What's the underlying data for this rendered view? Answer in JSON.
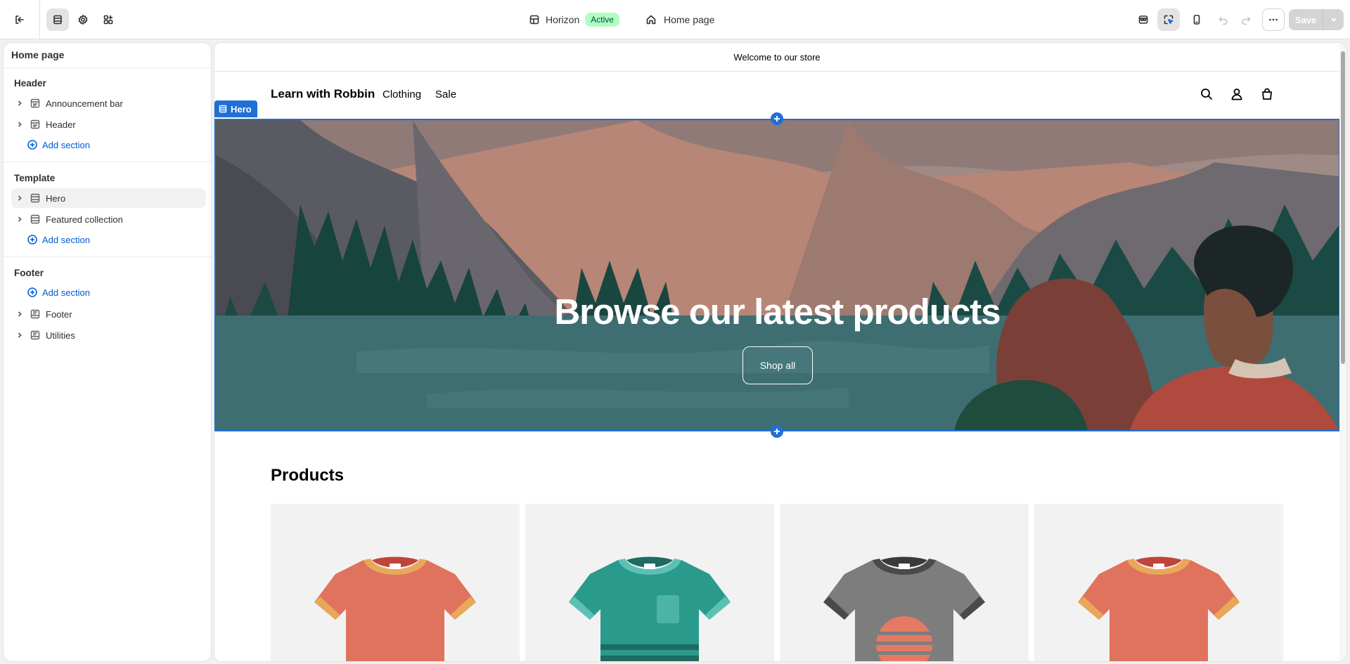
{
  "topbar": {
    "theme_name": "Horizon",
    "theme_status": "Active",
    "page_selector": "Home page",
    "save_label": "Save"
  },
  "sidebar": {
    "title": "Home page",
    "groups": [
      {
        "title": "Header",
        "items": [
          "Announcement bar",
          "Header"
        ],
        "add_label": "Add section"
      },
      {
        "title": "Template",
        "items": [
          "Hero",
          "Featured collection"
        ],
        "add_label": "Add section"
      },
      {
        "title": "Footer",
        "items": [
          "Footer",
          "Utilities"
        ],
        "add_label": "Add section"
      }
    ],
    "selected_item": "Hero"
  },
  "preview": {
    "announcement": "Welcome to our store",
    "store_name": "Learn with Robbin",
    "nav": [
      "Clothing",
      "Sale"
    ],
    "hero_tag": "Hero",
    "hero_title": "Browse our latest products",
    "hero_button": "Shop all",
    "products_title": "Products",
    "products": [
      {
        "color": "#e0735e",
        "trim": "#e8a85a"
      },
      {
        "color": "#2a9a8c",
        "trim": "#5cc1b4"
      },
      {
        "color": "#7d7d7d",
        "trim": "#4a4a4a"
      },
      {
        "color": "#e0735e",
        "trim": "#e8a85a"
      }
    ]
  },
  "colors": {
    "accent": "#1f6fd6",
    "link": "#005bd3",
    "badge_bg": "#affebf"
  }
}
